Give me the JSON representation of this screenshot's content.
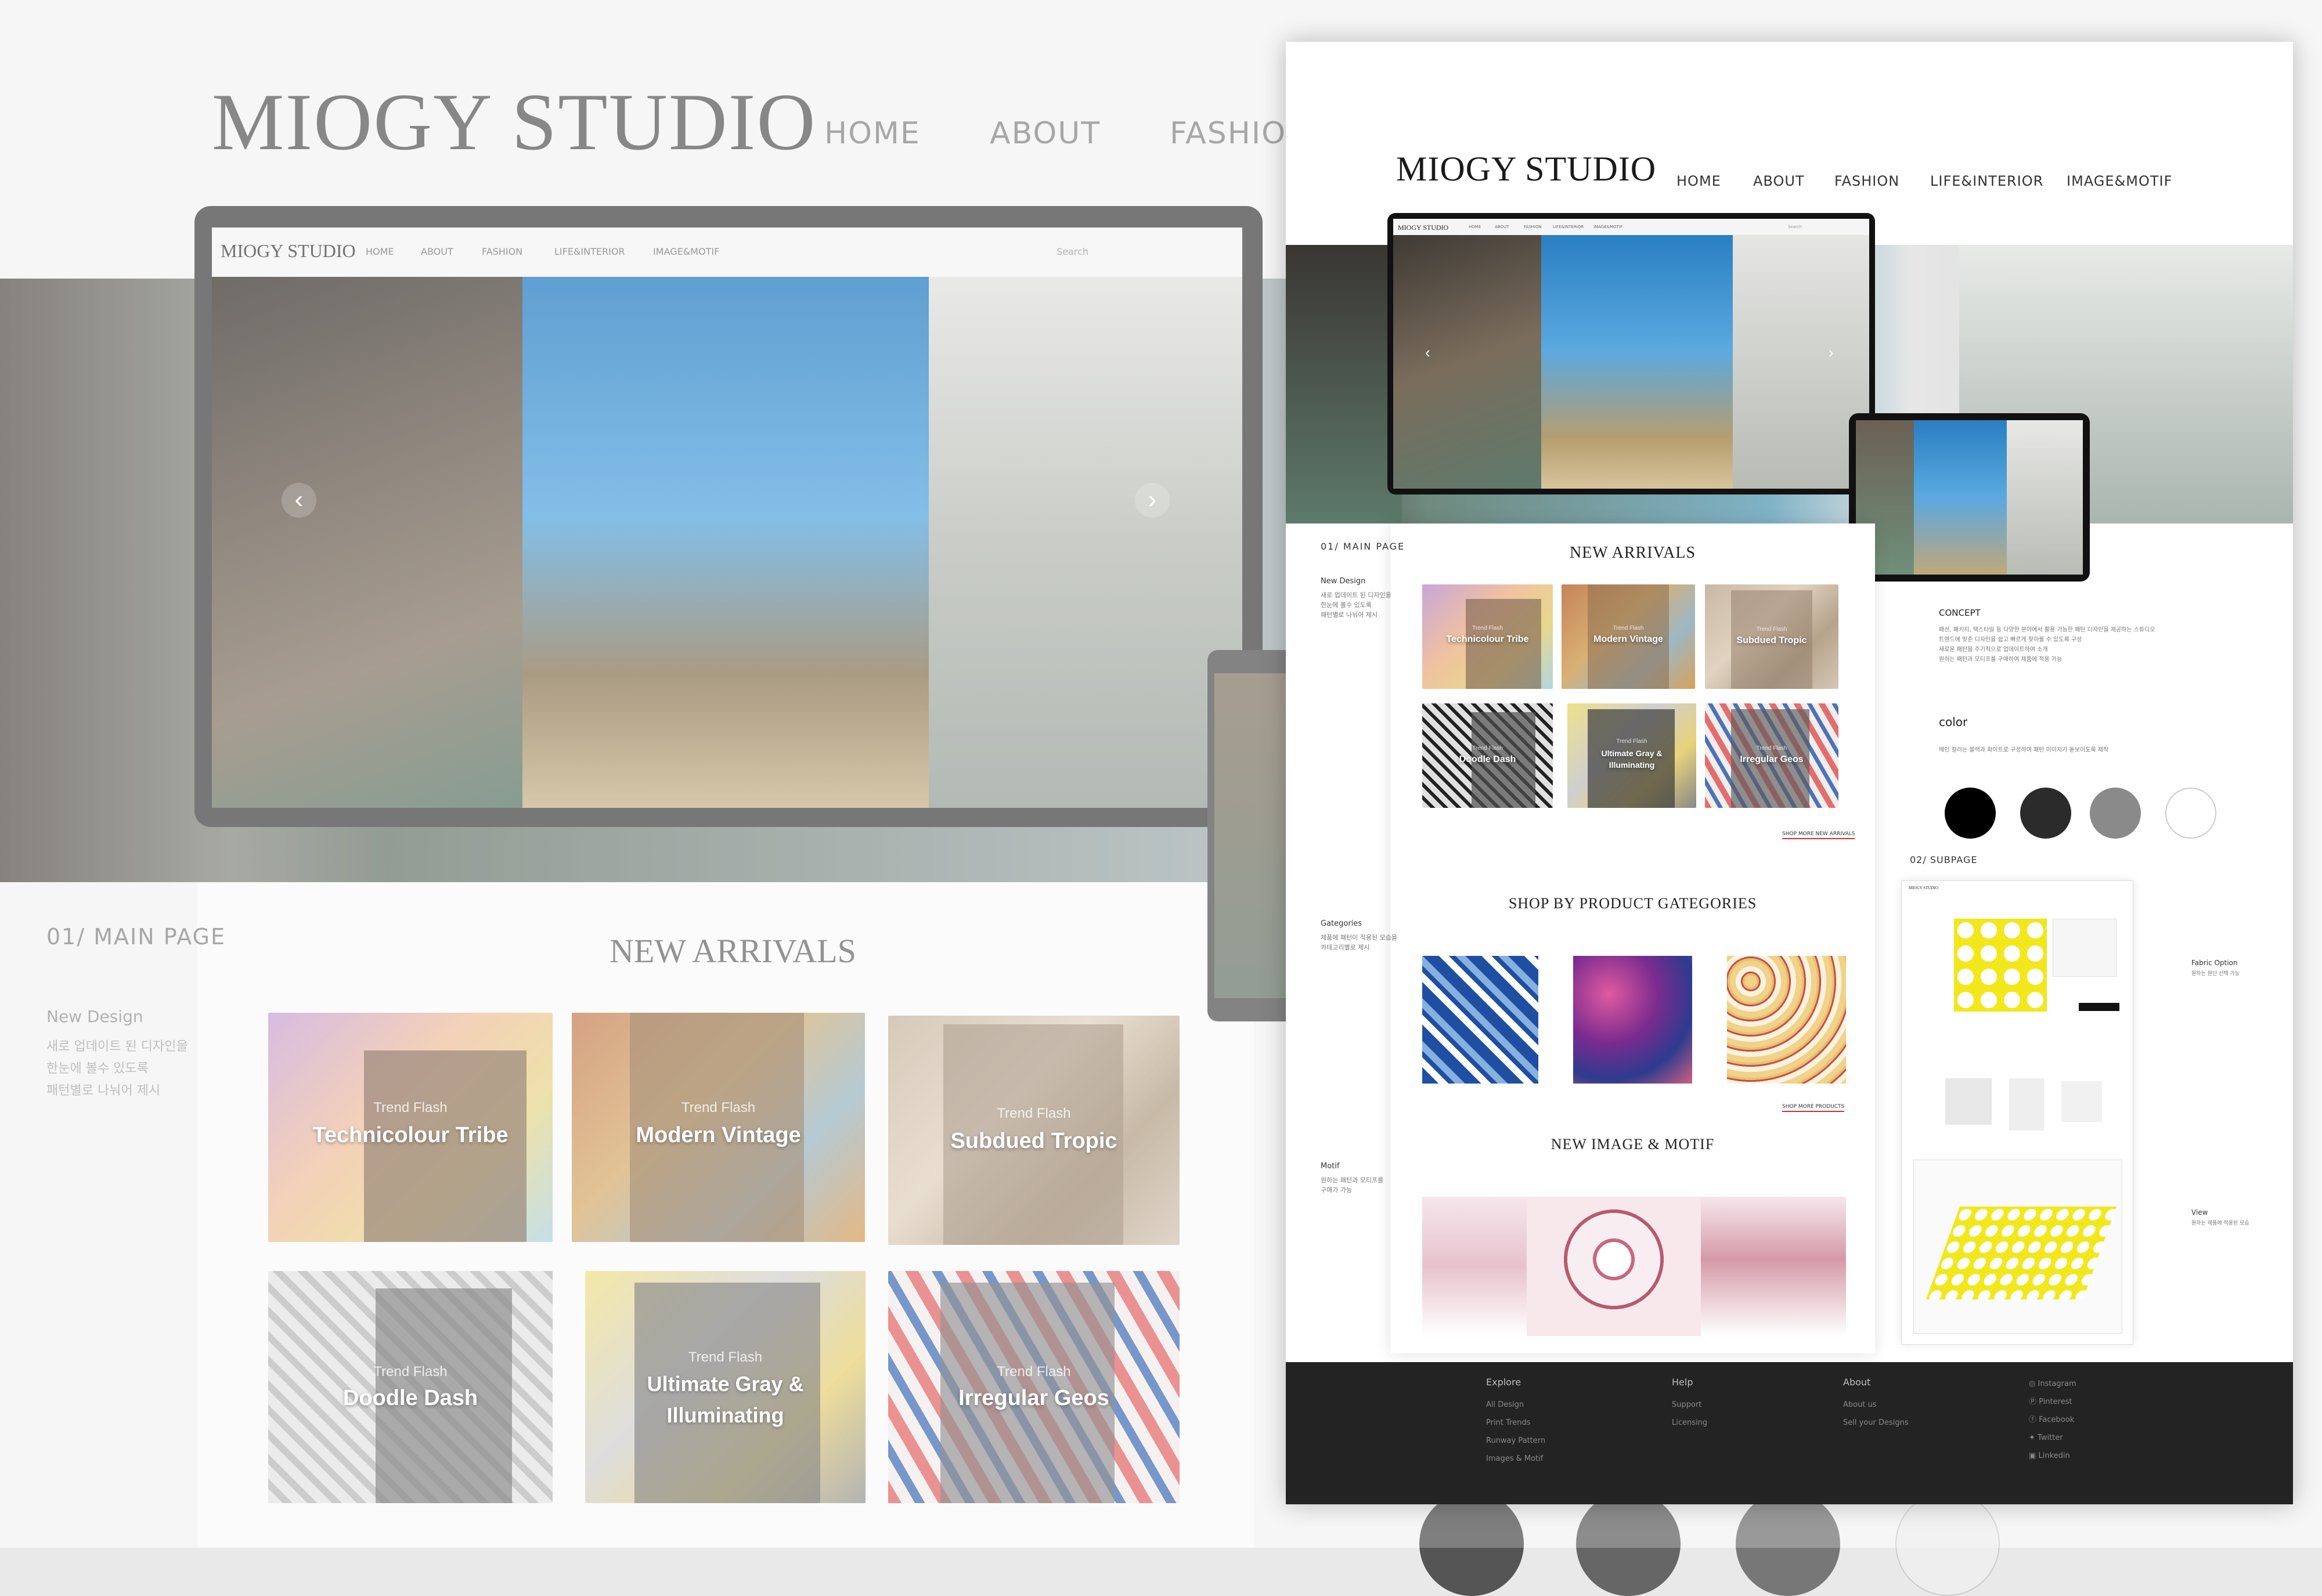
{
  "background_mockup": {
    "brand": "MIOGY STUDIO",
    "nav": [
      "HOME",
      "ABOUT",
      "FASHION"
    ],
    "laptop": {
      "brand": "MIOGY STUDIO",
      "nav": [
        "HOME",
        "ABOUT",
        "FASHION",
        "LIFE&INTERIOR",
        "IMAGE&MOTIF"
      ],
      "search_placeholder": "Search"
    },
    "section_label": "01/ MAIN PAGE",
    "new_design_title": "New Design",
    "new_design_text": [
      "새로 업데이트 된 디자인을",
      "한눈에 볼수 있도록",
      "패턴별로 나눠어 제시"
    ],
    "new_arrivals_title": "NEW ARRIVALS",
    "tiles": [
      {
        "small": "Trend Flash",
        "title": "Technicolour Tribe"
      },
      {
        "small": "Trend Flash",
        "title": "Modern Vintage"
      },
      {
        "small": "Trend Flash",
        "title": "Subdued Tropic"
      },
      {
        "small": "Trend Flash",
        "title": "Doodle Dash"
      },
      {
        "small": "Trend Flash",
        "title": "Ultimate Gray & Illuminating"
      },
      {
        "small": "Trend Flash",
        "title": "Irregular Geos"
      }
    ]
  },
  "front_page": {
    "brand": "MIOGY STUDIO",
    "nav": [
      "HOME",
      "ABOUT",
      "FASHION",
      "LIFE&INTERIOR",
      "IMAGE&MOTIF"
    ],
    "laptop_nav": [
      "HOME",
      "ABOUT",
      "FASHION",
      "LIFE&INTERIOR",
      "IMAGE&MOTIF"
    ],
    "laptop_search": "Search",
    "main_page_label": "01/ MAIN PAGE",
    "new_design_label": "New Design",
    "new_design_text": [
      "새로 업데이트 된 디자인을",
      "한눈에 볼수 있도록",
      "패턴별로 나눠어 제시"
    ],
    "categories_label": "Gategories",
    "categories_text": [
      "제품에 패턴이 적용된 모습을",
      "카테고리별로 제시"
    ],
    "motif_label": "Motif",
    "motif_text": [
      "원하는 패턴과 모티프를",
      "구매가 가능"
    ],
    "new_arrivals_title": "NEW ARRIVALS",
    "shop_more_arrivals": "SHOP MORE NEW ARRIVALS",
    "tiles": [
      {
        "small": "Trend Flash",
        "title": "Technicolour Tribe"
      },
      {
        "small": "Trend Flash",
        "title": "Modern Vintage"
      },
      {
        "small": "Trend Flash",
        "title": "Subdued Tropic"
      },
      {
        "small": "Trend Flash",
        "title": "Doodle Dash"
      },
      {
        "small": "Trend Flash",
        "title": "Ultimate Gray & Illuminating"
      },
      {
        "small": "Trend Flash",
        "title": "Irregular Geos"
      }
    ],
    "shop_by_title": "SHOP BY PRODUCT GATEGORIES",
    "shop_more_products": "SHOP MORE PRODUCTS",
    "new_motif_title": "NEW IMAGE & MOTIF",
    "concept_label": "CONCEPT",
    "concept_text": [
      "패션, 패키지, 텍스타일 등 다양한 분야에서 활용 가능한 패턴 디자인을 제공하는 스튜디오",
      "트렌드에 맞춘 디자인을 쉽고 빠르게 찾아볼 수 있도록 구성",
      "새로운 패턴을 주기적으로 업데이트하여 소개",
      "원하는 패턴과 모티프를 구매하여 제품에 적용 가능"
    ],
    "color_label": "color",
    "color_text": "메인 컬러는 블랙과 화이트로 구성하여 패턴 이미지가 돋보이도록 제작",
    "colors": [
      "#000000",
      "#2b2b2b",
      "#8a8a8a",
      "#ffffff"
    ],
    "subpage_label": "02/ SUBPAGE",
    "fabric_option_label": "Fabric Option",
    "fabric_option_text": "원하는 원단 선택 가능",
    "view_label": "View",
    "view_text": "원하는 제품에 적용된 모습",
    "subpage_brand": "MIOGY STUDIO",
    "footer": {
      "explore_title": "Explore",
      "explore_items": [
        "All Design",
        "Print Trends",
        "Runway Pattern",
        "Images & Motif"
      ],
      "help_title": "Help",
      "help_items": [
        "Support",
        "Licensing"
      ],
      "about_title": "About",
      "about_items": [
        "About us",
        "Sell your Designs"
      ],
      "social": [
        "Instagram",
        "Pinterest",
        "Facebook",
        "Twitter",
        "Linkedin"
      ]
    }
  },
  "colors": {
    "footer_bg": "#232323",
    "accent_red": "#c62828"
  }
}
